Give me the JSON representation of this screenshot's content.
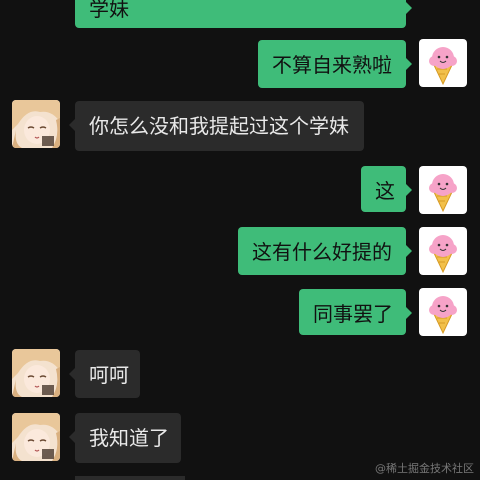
{
  "messages": [
    {
      "sender": "me",
      "text": "学妹"
    },
    {
      "sender": "me",
      "text": "不算自来熟啦"
    },
    {
      "sender": "other",
      "text": "你怎么没和我提起过这个学妹"
    },
    {
      "sender": "me",
      "text": "这"
    },
    {
      "sender": "me",
      "text": "这有什么好提的"
    },
    {
      "sender": "me",
      "text": "同事罢了"
    },
    {
      "sender": "other",
      "text": "呵呵"
    },
    {
      "sender": "other",
      "text": "我知道了"
    }
  ],
  "icons": {
    "me_avatar": "ice-cream-icon",
    "other_avatar": "anime-girl-avatar"
  },
  "watermark": "@稀土掘金技术社区",
  "colors": {
    "background": "#111111",
    "me_bubble": "#3fbc79",
    "other_bubble": "#2b2b2b"
  }
}
